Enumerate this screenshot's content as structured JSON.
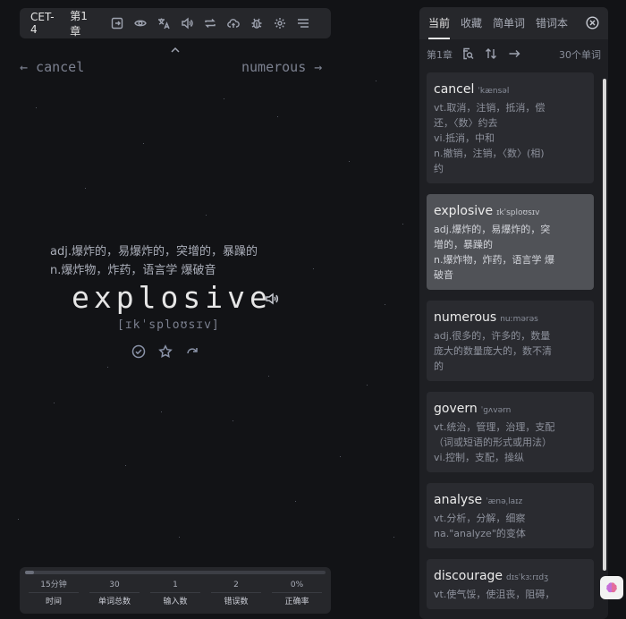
{
  "toolbar": {
    "dictionary": "CET-4",
    "chapter": "第1章",
    "icons": [
      "exit-icon",
      "eye-icon",
      "translate-icon",
      "speaker-icon",
      "loop-icon",
      "cloud-upload-icon",
      "bug-icon",
      "gear-icon",
      "menu-icon"
    ]
  },
  "nav": {
    "prev_word": "← cancel",
    "next_word": "numerous →"
  },
  "current": {
    "definitions": [
      "adj.爆炸的，易爆炸的，突增的，暴躁的",
      "n.爆炸物，炸药，语言学 爆破音"
    ],
    "word": "explosive",
    "phonetic": "[ɪkˈsploʊsɪv]"
  },
  "stats": {
    "progress_percent": 3,
    "items": [
      {
        "value": "15分钟",
        "label": "时间"
      },
      {
        "value": "30",
        "label": "单词总数"
      },
      {
        "value": "1",
        "label": "输入数"
      },
      {
        "value": "2",
        "label": "错误数"
      },
      {
        "value": "0%",
        "label": "正确率"
      }
    ]
  },
  "panel": {
    "tabs": [
      "当前",
      "收藏",
      "简单词",
      "错词本"
    ],
    "active_tab": 0,
    "chapter": "第1章",
    "word_count": "30个单词",
    "cards": [
      {
        "word": "cancel",
        "phonetic": "ˈkænsəl",
        "lines": [
          "vt.取消，注销，抵消，偿",
          "还，〈数〉约去",
          "vi.抵消，中和",
          "n.撤销，注销，〈数〉(相)",
          "约"
        ],
        "active": false
      },
      {
        "word": "explosive",
        "phonetic": "ɪkˈsploʊsɪv",
        "lines": [
          "adj.爆炸的，易爆炸的，突",
          "增的，暴躁的",
          "n.爆炸物，炸药，语言学 爆",
          "破音"
        ],
        "active": true
      },
      {
        "word": "numerous",
        "phonetic": "nuːmərəs",
        "lines": [
          "adj.很多的，许多的，数量",
          "庞大的数量庞大的，数不清",
          "的"
        ],
        "active": false
      },
      {
        "word": "govern",
        "phonetic": "ˈɡʌvərn",
        "lines": [
          "vt.统治，管理，治理，支配",
          "（词或短语的形式或用法）",
          "vi.控制，支配，操纵"
        ],
        "active": false
      },
      {
        "word": "analyse",
        "phonetic": "ˈænəˌlaɪz",
        "lines": [
          "vt.分析，分解，细察",
          "na.\"analyze\"的变体"
        ],
        "active": false
      },
      {
        "word": "discourage",
        "phonetic": "dɪsˈkɜːrɪdʒ",
        "lines": [
          "vt.使气馁，使沮丧，阻碍，"
        ],
        "active": false
      }
    ]
  },
  "colors": {
    "background": "#121316",
    "panel": "#1e1f23",
    "card": "#2a2b30",
    "card_active": "#505257"
  }
}
